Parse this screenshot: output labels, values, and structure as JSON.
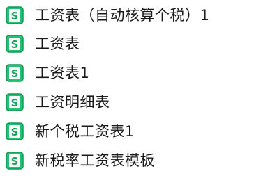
{
  "files": [
    {
      "name": "工资表（自动核算个税）1",
      "icon": "sheet-file-icon"
    },
    {
      "name": "工资表",
      "icon": "sheet-file-icon"
    },
    {
      "name": "工资表1",
      "icon": "sheet-file-icon"
    },
    {
      "name": "工资明细表",
      "icon": "sheet-file-icon"
    },
    {
      "name": "新个税工资表1",
      "icon": "sheet-file-icon"
    },
    {
      "name": "新税率工资表模板",
      "icon": "sheet-file-icon"
    }
  ],
  "colors": {
    "icon_light": "#20c26e",
    "icon_dark": "#0f9d58",
    "icon_letter": "#ffffff",
    "text": "#1a1a1a",
    "background": "#ffffff"
  }
}
